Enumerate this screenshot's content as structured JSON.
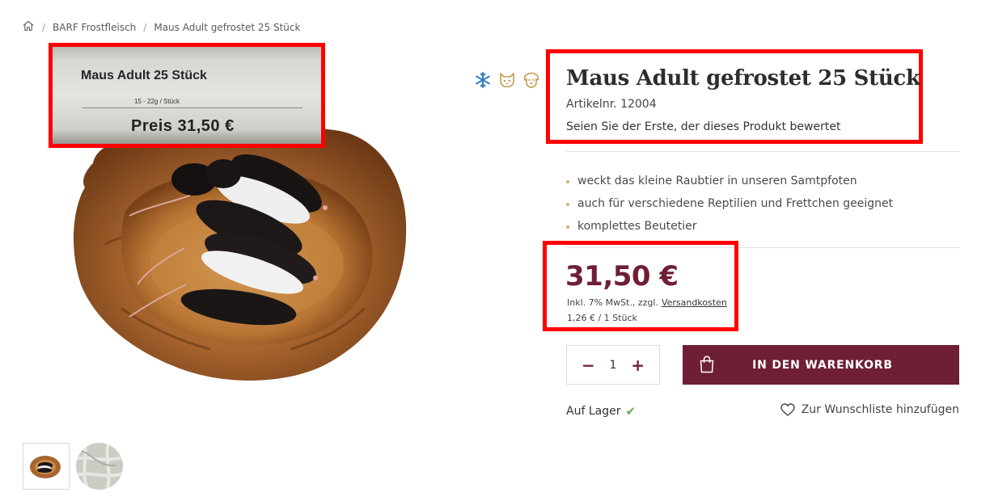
{
  "breadcrumb": {
    "home_icon": "home-icon",
    "separator": "/",
    "items": [
      "BARF Frostfleisch",
      "Maus Adult gefrostet 25 Stück"
    ]
  },
  "gallery": {
    "price_tag": {
      "name": "Maus Adult 25 Stück",
      "weight": "15 - 22g / Stück",
      "price": "Preis 31,50 €"
    },
    "thumbnail_count": 2
  },
  "badges": [
    "snowflake-icon",
    "cat-icon",
    "dog-icon"
  ],
  "product": {
    "title": "Maus Adult gefrostet 25 Stück",
    "article_number": "Artikelnr. 12004",
    "review_text": "Seien Sie der Erste, der dieses Produkt bewertet",
    "features": [
      "weckt das kleine Raubtier in unseren Samtpfoten",
      "auch für verschiedene Reptilien und Frettchen geeignet",
      "komplettes Beutetier"
    ],
    "price": "31,50 €",
    "tax_text": "Inkl. 7% MwSt., zzgl.",
    "shipping_link": "Versandkosten",
    "unit_price": "1,26 € / 1 Stück",
    "quantity": "1",
    "minus": "−",
    "plus": "+",
    "cart_button": "IN DEN WARENKORB",
    "stock": "Auf Lager",
    "stock_check": "✔",
    "wishlist": "Zur Wunschliste hinzufügen"
  },
  "colors": {
    "brand": "#6f1f34",
    "highlight": "#ff0000",
    "accent_bullet": "#d4b06a",
    "in_stock": "#6aa84f"
  }
}
